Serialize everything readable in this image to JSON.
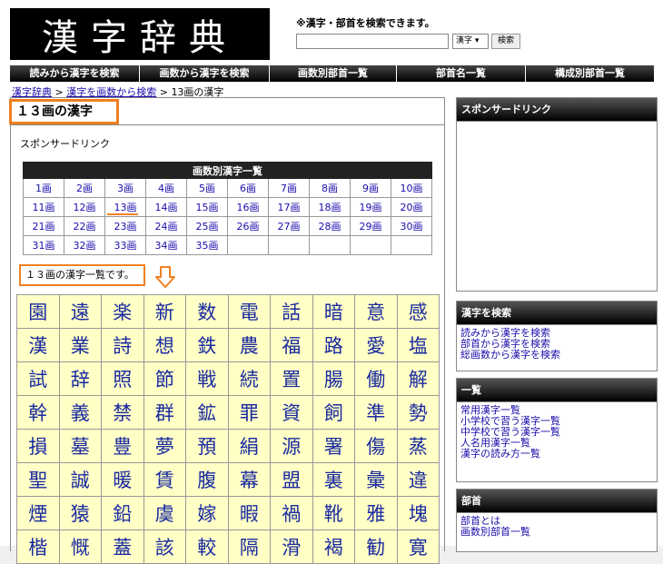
{
  "header": {
    "logo": "漢字辞典",
    "note": "※漢字・部首を検索できます。",
    "select_value": "漢字",
    "search_button": "検索",
    "search_value": ""
  },
  "nav": [
    "読みから漢字を検索",
    "画数から漢字を検索",
    "画数別部首一覧",
    "部首名一覧",
    "構成別部首一覧"
  ],
  "breadcrumb": {
    "items": [
      "漢字辞典",
      "漢字を画数から検索",
      "13画の漢字"
    ],
    "separator": " > "
  },
  "main": {
    "title": "１３画の漢字",
    "sponsor": "スポンサードリンク",
    "table_title": "画数別漢字一覧",
    "info": "１３画の漢字一覧です。"
  },
  "strokes": [
    [
      "1画",
      "2画",
      "3画",
      "4画",
      "5画",
      "6画",
      "7画",
      "8画",
      "9画",
      "10画"
    ],
    [
      "11画",
      "12画",
      "13画",
      "14画",
      "15画",
      "16画",
      "17画",
      "18画",
      "19画",
      "20画"
    ],
    [
      "21画",
      "22画",
      "23画",
      "24画",
      "25画",
      "26画",
      "27画",
      "28画",
      "29画",
      "30画"
    ],
    [
      "31画",
      "32画",
      "33画",
      "34画",
      "35画",
      "",
      "",
      "",
      "",
      ""
    ]
  ],
  "kanji": [
    [
      "園",
      "遠",
      "楽",
      "新",
      "数",
      "電",
      "話",
      "暗",
      "意",
      "感"
    ],
    [
      "漢",
      "業",
      "詩",
      "想",
      "鉄",
      "農",
      "福",
      "路",
      "愛",
      "塩"
    ],
    [
      "試",
      "辞",
      "照",
      "節",
      "戦",
      "続",
      "置",
      "腸",
      "働",
      "解"
    ],
    [
      "幹",
      "義",
      "禁",
      "群",
      "鉱",
      "罪",
      "資",
      "飼",
      "準",
      "勢"
    ],
    [
      "損",
      "墓",
      "豊",
      "夢",
      "預",
      "絹",
      "源",
      "署",
      "傷",
      "蒸"
    ],
    [
      "聖",
      "誠",
      "暖",
      "賃",
      "腹",
      "幕",
      "盟",
      "裏",
      "彙",
      "違"
    ],
    [
      "煙",
      "猿",
      "鉛",
      "虞",
      "嫁",
      "暇",
      "禍",
      "靴",
      "雅",
      "塊"
    ],
    [
      "楷",
      "慨",
      "蓋",
      "該",
      "較",
      "隔",
      "滑",
      "褐",
      "勧",
      "寛"
    ]
  ],
  "sidebar": {
    "sponsor_head": "スポンサードリンク",
    "search_head": "漢字を検索",
    "search_links": [
      "読みから漢字を検索",
      "部首から漢字を検索",
      "総画数から漢字を検索"
    ],
    "list_head": "一覧",
    "list_links": [
      "常用漢字一覧",
      "小学校で習う漢字一覧",
      "中学校で習う漢字一覧",
      "人名用漢字一覧",
      "漢字の読み方一覧"
    ],
    "radical_head": "部首",
    "radical_links": [
      "部首とは",
      "画数別部首一覧"
    ]
  },
  "colors": {
    "accent": "#f08020",
    "link": "#1a0dab",
    "kanji_bg": "#ffffc6"
  }
}
